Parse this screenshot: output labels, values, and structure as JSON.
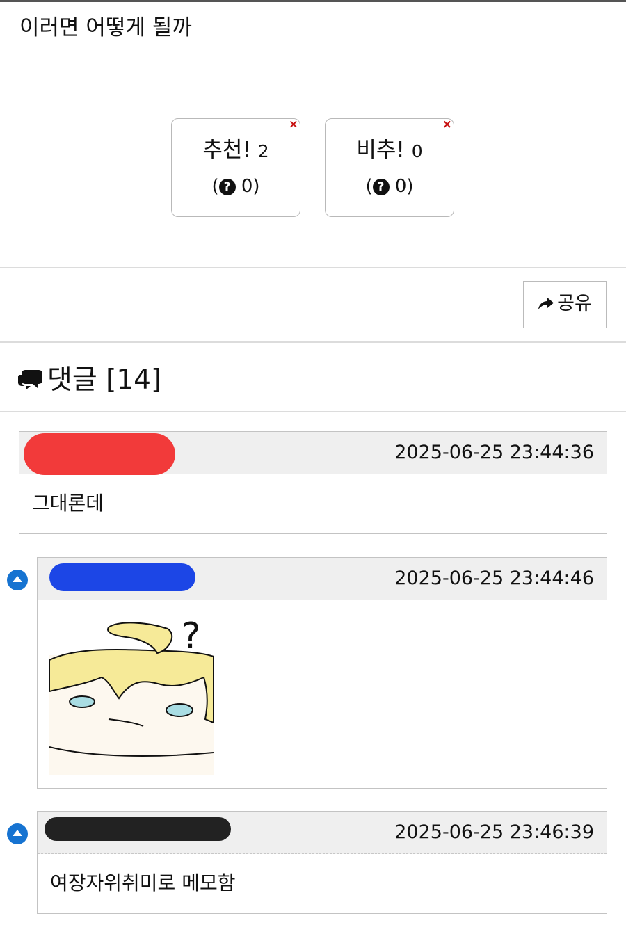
{
  "post": {
    "body_text": "이러면 어떻게 될까"
  },
  "votes": {
    "up": {
      "label": "추천!",
      "count": "2",
      "sub_open": "(",
      "sub_count": " 0)",
      "q_symbol": "?"
    },
    "down": {
      "label": "비추!",
      "count": "0",
      "sub_open": "(",
      "sub_count": " 0)",
      "q_symbol": "?"
    },
    "close_symbol": "×"
  },
  "share": {
    "label": "공유"
  },
  "comments_header": {
    "label": "댓글 [14]"
  },
  "comments": [
    {
      "date": "2025-06-25 23:44:36",
      "text": "그대론데",
      "reply": false
    },
    {
      "date": "2025-06-25 23:44:46",
      "text": "",
      "reply": true
    },
    {
      "date": "2025-06-25 23:46:39",
      "text": "여장자위취미로 메모함",
      "reply": true
    }
  ],
  "colors": {
    "reply_icon": "#1673d1",
    "close_x": "#c81010",
    "header_bg": "#efefef"
  }
}
